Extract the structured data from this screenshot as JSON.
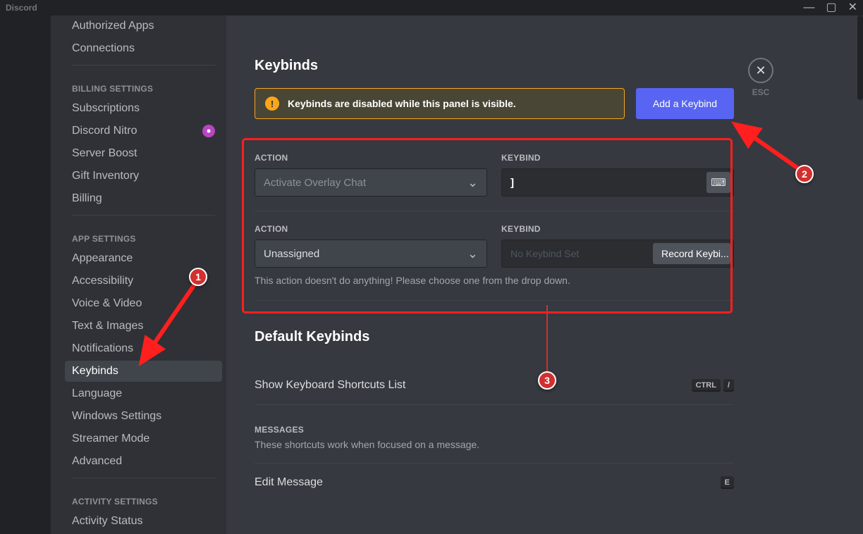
{
  "titlebar": {
    "app_name": "Discord"
  },
  "sidebar": {
    "items_top": [
      {
        "label": "Authorized Apps"
      },
      {
        "label": "Connections"
      }
    ],
    "billing_header": "BILLING SETTINGS",
    "billing_items": [
      {
        "label": "Subscriptions"
      },
      {
        "label": "Discord Nitro",
        "nitro": true
      },
      {
        "label": "Server Boost"
      },
      {
        "label": "Gift Inventory"
      },
      {
        "label": "Billing"
      }
    ],
    "app_header": "APP SETTINGS",
    "app_items": [
      {
        "label": "Appearance"
      },
      {
        "label": "Accessibility"
      },
      {
        "label": "Voice & Video"
      },
      {
        "label": "Text & Images"
      },
      {
        "label": "Notifications"
      },
      {
        "label": "Keybinds",
        "active": true
      },
      {
        "label": "Language"
      },
      {
        "label": "Windows Settings"
      },
      {
        "label": "Streamer Mode"
      },
      {
        "label": "Advanced"
      }
    ],
    "activity_header": "ACTIVITY SETTINGS",
    "activity_items": [
      {
        "label": "Activity Status"
      }
    ]
  },
  "page": {
    "title": "Keybinds",
    "warning": "Keybinds are disabled while this panel is visible.",
    "add_button": "Add a Keybind",
    "esc_label": "ESC",
    "action_label": "ACTION",
    "keybind_label": "KEYBIND",
    "rows": [
      {
        "action_value": "Activate Overlay Chat",
        "action_dimmed": true,
        "keybind_value": "]",
        "has_icon": true
      },
      {
        "action_value": "Unassigned",
        "action_dimmed": false,
        "keybind_placeholder": "No Keybind Set",
        "record_label": "Record Keybi...",
        "help": "This action doesn't do anything! Please choose one from the drop down."
      }
    ],
    "default_title": "Default Keybinds",
    "defaults": [
      {
        "label": "Show Keyboard Shortcuts List",
        "keys": [
          "CTRL",
          "/"
        ]
      }
    ],
    "messages_heading": "MESSAGES",
    "messages_desc": "These shortcuts work when focused on a message.",
    "edit_label": "Edit Message",
    "edit_key": "E"
  },
  "annotations": {
    "markers": [
      "1",
      "2",
      "3"
    ]
  }
}
